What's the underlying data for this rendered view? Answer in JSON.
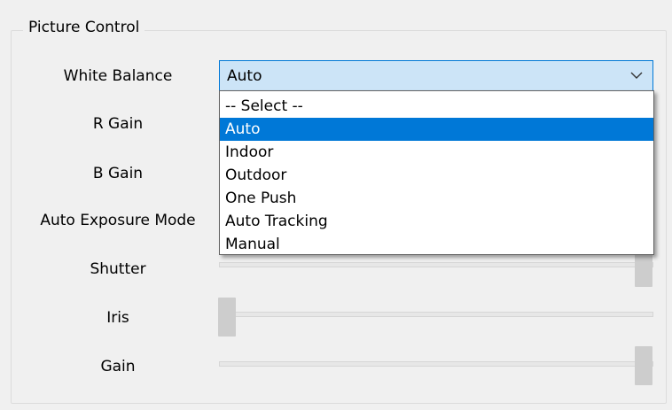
{
  "group": {
    "title": "Picture Control"
  },
  "labels": {
    "white_balance": "White Balance",
    "r_gain": "R Gain",
    "b_gain": "B Gain",
    "auto_exposure_mode": "Auto Exposure Mode",
    "shutter": "Shutter",
    "iris": "Iris",
    "gain": "Gain"
  },
  "white_balance": {
    "selected": "Auto",
    "arrow_icon": "chevron-down-icon",
    "options": [
      "-- Select --",
      "Auto",
      "Indoor",
      "Outdoor",
      "One Push",
      "Auto Tracking",
      "Manual"
    ],
    "highlighted_index": 1
  },
  "sliders": {
    "shutter": {
      "level": 1.0
    },
    "iris": {
      "level": 0.0
    },
    "gain": {
      "level": 1.0
    }
  },
  "colors": {
    "selection": "#0078d7",
    "combo_focus_bg": "#cce4f7",
    "window_bg": "#f0f0f0"
  }
}
